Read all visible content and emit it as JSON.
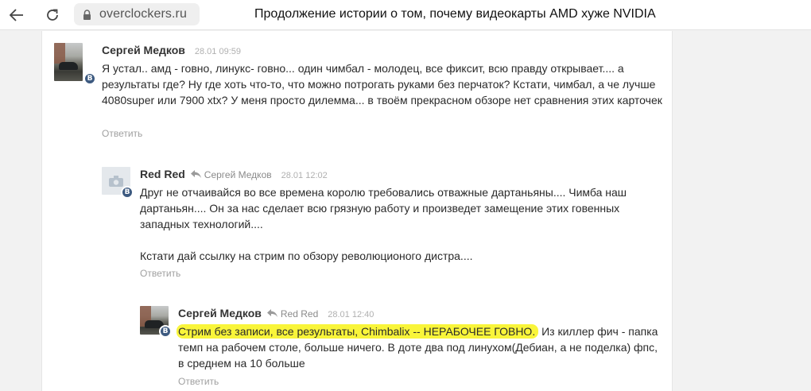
{
  "browser": {
    "url": "overclockers.ru",
    "page_title": "Продолжение истории о том, почему видеокарты AMD хуже NVIDIA",
    "icons": {
      "back": "arrow-left-icon",
      "reload": "reload-icon",
      "lock": "lock-icon"
    }
  },
  "comments": [
    {
      "author": "Сергей Медков",
      "date": "28.01 09:59",
      "text": "Я устал.. амд - говно, линукс- говно... один чимбал - молодец, все фиксит, всю правду открывает.... а результаты где? Ну где хоть что-то, что можно потрогать руками без перчаток? Кстати, чимбал, а че лучше 4080super или 7900 xtx? У меня просто дилемма... в твоём прекрасном обзоре нет сравнения этих карточек",
      "reply_label": "Ответить",
      "badge": "В"
    },
    {
      "author": "Red Red",
      "reply_to": "Сергей Медков",
      "date": "28.01 12:02",
      "text_p1": "Друг не отчаивайся во все времена королю требовались отважные дартаньяны.... Чимба наш дартаньян.... Он за нас сделает всю грязную работу и произведет замещение этих говенных западных технологий....",
      "text_p2": "Кстати дай ссылку на стрим по обзору революционого дистра....",
      "reply_label": "Ответить",
      "badge": "В"
    },
    {
      "author": "Сергей Медков",
      "reply_to": "Red Red",
      "date": "28.01 12:40",
      "text_highlight": "Стрим без записи, все результаты, Chimbalix -- НЕРАБОЧЕЕ ГОВНО.",
      "text_rest": " Из киллер фич - папка темп на рабочем столе, больше ничего. В доте два под линухом(Дебиан, а не поделка) фпс, в среднем на 10 больше",
      "reply_label": "Ответить",
      "badge": "В"
    }
  ],
  "colors": {
    "highlight": "#f9f53a",
    "badge": "#3d5a80",
    "muted": "#a0a0a0"
  }
}
